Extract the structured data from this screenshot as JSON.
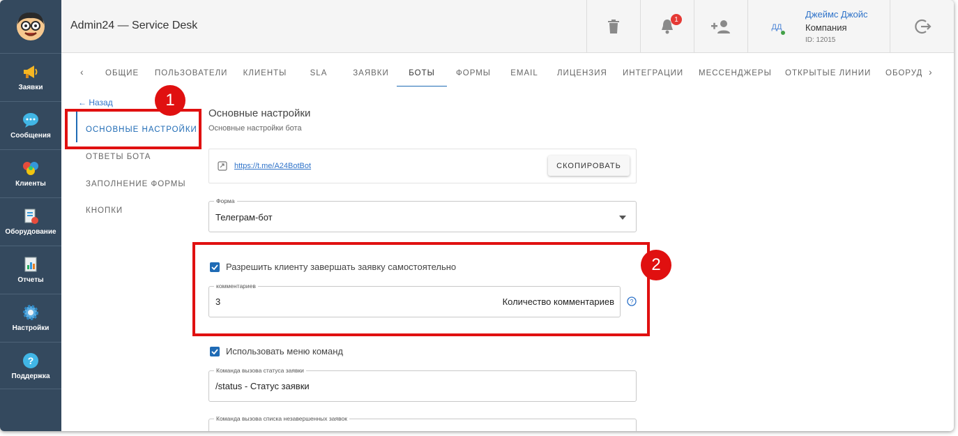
{
  "header": {
    "title": "Admin24 — Service Desk",
    "notifications_count": "1",
    "user_initials": "ДД",
    "user_name": "Джеймс Джойс",
    "company": "Компания",
    "user_id": "ID: 12015"
  },
  "sidebar": {
    "items": [
      {
        "label": "Заявки",
        "icon": "megaphone-icon"
      },
      {
        "label": "Сообщения",
        "icon": "chat-icon"
      },
      {
        "label": "Клиенты",
        "icon": "clients-icon"
      },
      {
        "label": "Оборудование",
        "icon": "equipment-icon"
      },
      {
        "label": "Отчеты",
        "icon": "report-icon"
      },
      {
        "label": "Настройки",
        "icon": "gear-icon"
      },
      {
        "label": "Поддержка",
        "icon": "help-icon"
      }
    ]
  },
  "tabs": [
    {
      "label": "ОБЩИЕ"
    },
    {
      "label": "ПОЛЬЗОВАТЕЛИ"
    },
    {
      "label": "КЛИЕНТЫ"
    },
    {
      "label": "SLA"
    },
    {
      "label": "ЗАЯВКИ"
    },
    {
      "label": "БОТЫ",
      "active": true
    },
    {
      "label": "ФОРМЫ"
    },
    {
      "label": "EMAIL"
    },
    {
      "label": "ЛИЦЕНЗИЯ"
    },
    {
      "label": "ИНТЕГРАЦИИ"
    },
    {
      "label": "МЕССЕНДЖЕРЫ"
    },
    {
      "label": "ОТКРЫТЫЕ ЛИНИИ"
    },
    {
      "label": "ОБОРУДОВ"
    }
  ],
  "submenu": {
    "back": "Назад",
    "items": [
      {
        "label": "ОСНОВНЫЕ НАСТРОЙКИ",
        "active": true
      },
      {
        "label": "ОТВЕТЫ БОТА"
      },
      {
        "label": "ЗАПОЛНЕНИЕ ФОРМЫ"
      },
      {
        "label": "КНОПКИ"
      }
    ]
  },
  "main": {
    "title": "Основные настройки",
    "subtitle": "Основные настройки бота",
    "bot_link": "https://t.me/A24BotBot",
    "copy_button": "СКОПИРОВАТЬ",
    "form_field": {
      "label": "Форма",
      "value": "Телеграм-бот"
    },
    "allow_close_checkbox": {
      "label": "Разрешить клиенту завершать заявку самостоятельно",
      "checked": true
    },
    "comments_field": {
      "label": "комментариев",
      "value": "3",
      "suffix": "Количество комментариев"
    },
    "command_menu_checkbox": {
      "label": "Использовать меню команд",
      "checked": true
    },
    "status_command_field": {
      "label": "Команда вызова статуса заявки",
      "value": "/status - Статус заявки"
    },
    "unfinished_command_field": {
      "label": "Команда вызова списка незавершенных заявок",
      "value": ""
    }
  },
  "annotations": [
    "1",
    "2"
  ],
  "colors": {
    "sidebar": "#34495e",
    "accent": "#1f6bb5",
    "annotation": "#e01010"
  }
}
